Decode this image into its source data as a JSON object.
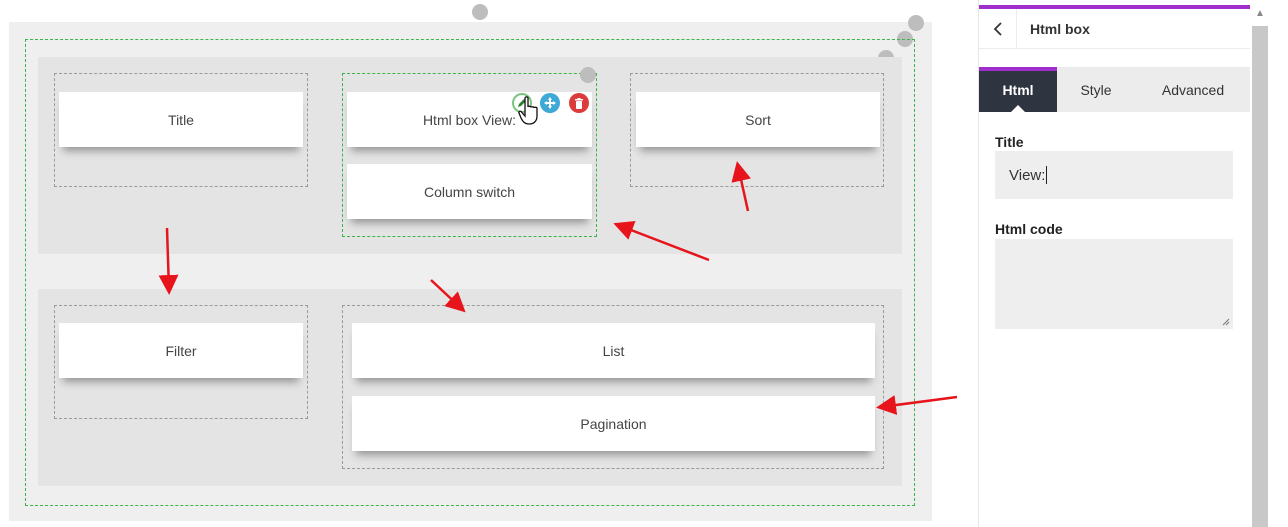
{
  "canvas": {
    "widgets": {
      "title": "Title",
      "html_box": "Html box View:",
      "column_switch": "Column switch",
      "sort": "Sort",
      "filter": "Filter",
      "list": "List",
      "pagination": "Pagination"
    },
    "controls": [
      "edit-icon",
      "move-icon",
      "delete-icon"
    ],
    "colors": {
      "active_outline": "#3bb54a",
      "arrow": "#e8141b",
      "edit": "#7bc57f",
      "move": "#3ea8d6",
      "delete": "#dc3b3b"
    }
  },
  "panel": {
    "back_icon": "chevron-left-icon",
    "title": "Html box",
    "tabs": [
      {
        "label": "Html",
        "active": true
      },
      {
        "label": "Style",
        "active": false
      },
      {
        "label": "Advanced",
        "active": false
      }
    ],
    "title_field": {
      "label": "Title",
      "value": "View:"
    },
    "html_code_field": {
      "label": "Html code",
      "value": ""
    },
    "accent": "#a02ecc"
  }
}
